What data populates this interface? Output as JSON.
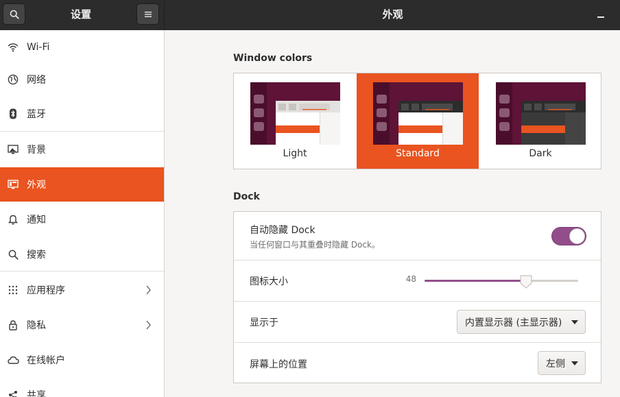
{
  "header": {
    "left_title": "设置",
    "right_title": "外观",
    "search_icon": "search-icon",
    "menu_icon": "hamburger-menu-icon",
    "minimize_icon": "minimize-icon"
  },
  "sidebar": {
    "items": [
      {
        "label": "Wi-Fi",
        "icon": "wifi-icon",
        "chevron": false,
        "active": false
      },
      {
        "label": "网络",
        "icon": "network-icon",
        "chevron": false,
        "active": false
      },
      {
        "label": "蓝牙",
        "icon": "bluetooth-icon",
        "chevron": false,
        "active": false
      },
      {
        "label": "背景",
        "icon": "background-icon",
        "chevron": false,
        "active": false
      },
      {
        "label": "外观",
        "icon": "appearance-icon",
        "chevron": false,
        "active": true
      },
      {
        "label": "通知",
        "icon": "bell-icon",
        "chevron": false,
        "active": false
      },
      {
        "label": "搜索",
        "icon": "search-icon",
        "chevron": false,
        "active": false
      },
      {
        "label": "应用程序",
        "icon": "apps-grid-icon",
        "chevron": true,
        "active": false
      },
      {
        "label": "隐私",
        "icon": "lock-icon",
        "chevron": true,
        "active": false
      },
      {
        "label": "在线帐户",
        "icon": "cloud-icon",
        "chevron": false,
        "active": false
      },
      {
        "label": "共享",
        "icon": "share-icon",
        "chevron": false,
        "active": false
      }
    ]
  },
  "window_colors": {
    "title": "Window colors",
    "options": [
      {
        "label": "Light",
        "selected": false
      },
      {
        "label": "Standard",
        "selected": true
      },
      {
        "label": "Dark",
        "selected": false
      }
    ]
  },
  "dock": {
    "title": "Dock",
    "autohide": {
      "label": "自动隐藏 Dock",
      "sublabel": "当任何窗口与其重叠时隐藏 Dock。",
      "enabled": true
    },
    "icon_size": {
      "label": "图标大小",
      "value": "48",
      "fraction": 0.66
    },
    "show_on": {
      "label": "显示于",
      "value": "内置显示器 (主显示器)"
    },
    "position": {
      "label": "屏幕上的位置",
      "value": "左侧"
    }
  },
  "colors": {
    "accent": "#e95420",
    "toggle_on": "#924d8b",
    "header_bg": "#2c2c2c",
    "aubergine": "#5e1337"
  }
}
